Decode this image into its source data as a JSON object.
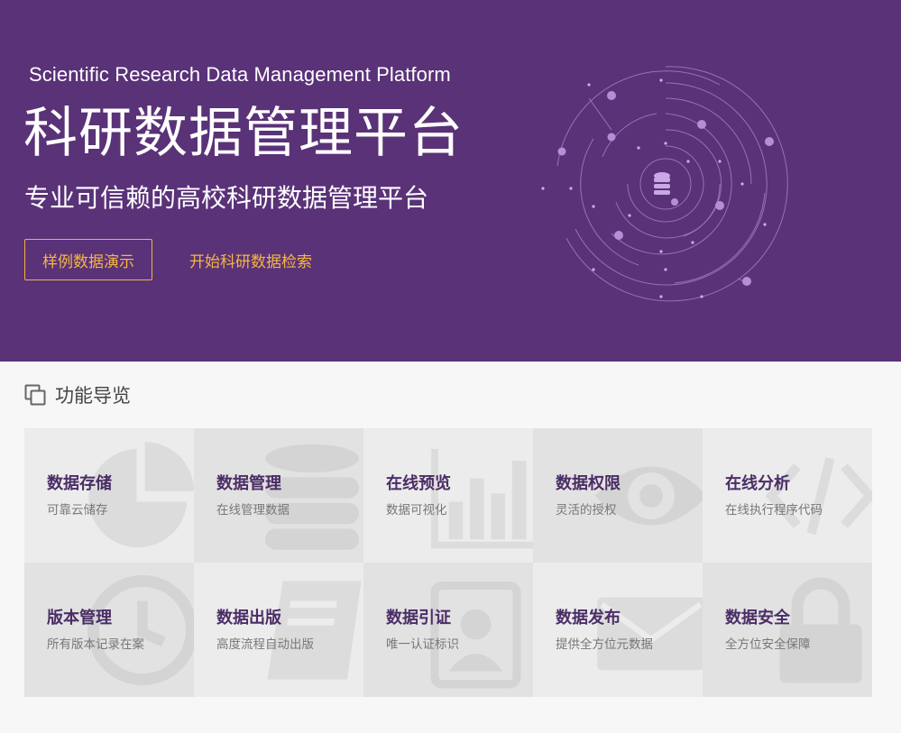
{
  "hero": {
    "subtitle_en": "Scientific Research Data Management Platform",
    "title": "科研数据管理平台",
    "tagline": "专业可信赖的高校科研数据管理平台",
    "demo_button": "样例数据演示",
    "search_button": "开始科研数据检索"
  },
  "section": {
    "title": "功能导览"
  },
  "features": [
    {
      "title": "数据存储",
      "desc": "可靠云储存",
      "icon": "pie-chart-icon"
    },
    {
      "title": "数据管理",
      "desc": "在线管理数据",
      "icon": "database-icon"
    },
    {
      "title": "在线预览",
      "desc": "数据可视化",
      "icon": "bar-chart-icon"
    },
    {
      "title": "数据权限",
      "desc": "灵活的授权",
      "icon": "eye-icon"
    },
    {
      "title": "在线分析",
      "desc": "在线执行程序代码",
      "icon": "code-icon"
    },
    {
      "title": "版本管理",
      "desc": "所有版本记录在案",
      "icon": "clock-icon"
    },
    {
      "title": "数据出版",
      "desc": "高度流程自动出版",
      "icon": "book-icon"
    },
    {
      "title": "数据引证",
      "desc": "唯一认证标识",
      "icon": "id-badge-icon"
    },
    {
      "title": "数据发布",
      "desc": "提供全方位元数据",
      "icon": "envelope-icon"
    },
    {
      "title": "数据安全",
      "desc": "全方位安全保障",
      "icon": "lock-icon"
    }
  ],
  "colors": {
    "hero_bg": "#5a3278",
    "accent": "#f5b642",
    "card_title": "#4a2d66"
  }
}
